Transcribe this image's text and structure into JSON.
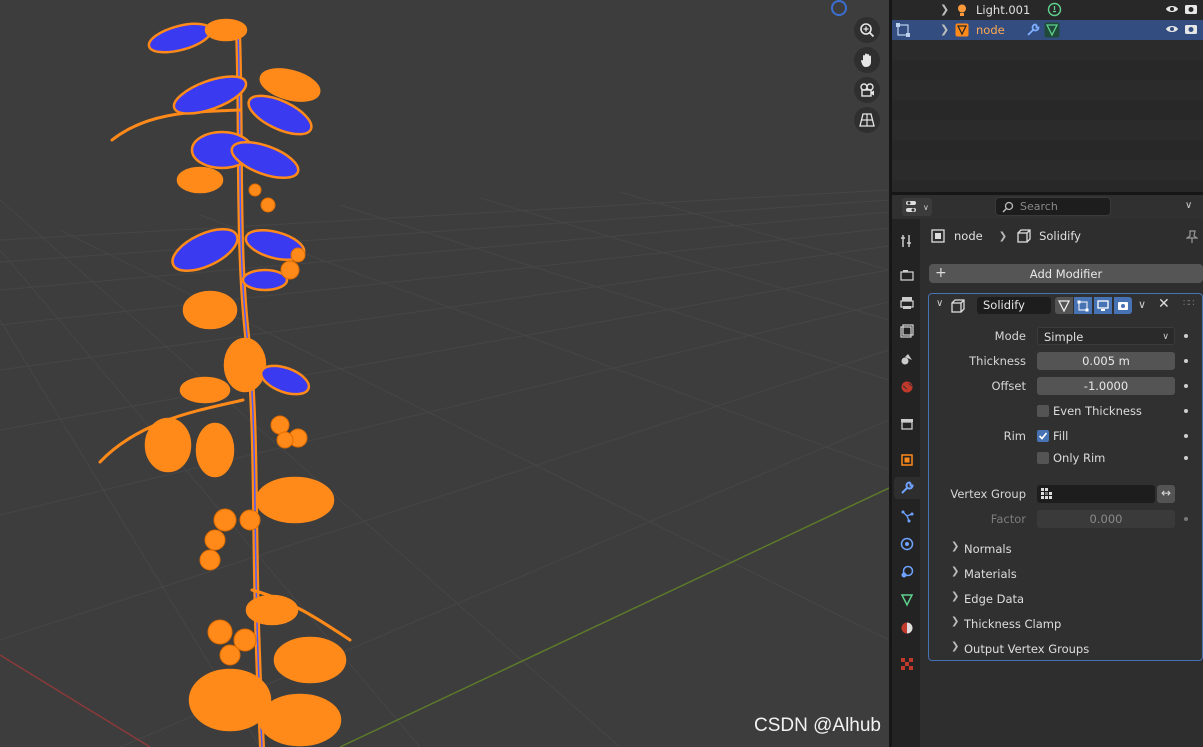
{
  "outliner": {
    "rows": [
      {
        "label": "Light.001",
        "selected": false
      },
      {
        "label": "node",
        "selected": true
      }
    ]
  },
  "properties": {
    "search_placeholder": "Search",
    "breadcrumb": {
      "object": "node",
      "modifier": "Solidify"
    },
    "add_modifier_label": "Add Modifier",
    "modifier": {
      "name": "Solidify",
      "mode": {
        "label": "Mode",
        "value": "Simple"
      },
      "thickness": {
        "label": "Thickness",
        "value": "0.005 m"
      },
      "offset": {
        "label": "Offset",
        "value": "-1.0000"
      },
      "even_thickness": {
        "label": "Even Thickness",
        "checked": false
      },
      "rim_label": "Rim",
      "fill": {
        "label": "Fill",
        "checked": true
      },
      "only_rim": {
        "label": "Only Rim",
        "checked": false
      },
      "vertex_group": {
        "label": "Vertex Group",
        "value": ""
      },
      "factor": {
        "label": "Factor",
        "value": "0.000"
      },
      "subpanels": [
        "Normals",
        "Materials",
        "Edge Data",
        "Thickness Clamp",
        "Output Vertex Groups"
      ]
    }
  },
  "watermark": "CSDN @Alhub",
  "colors": {
    "selection_blue": "#4772b3",
    "object_orange": "#ff8a1a",
    "face_blue": "#3a3af0"
  }
}
